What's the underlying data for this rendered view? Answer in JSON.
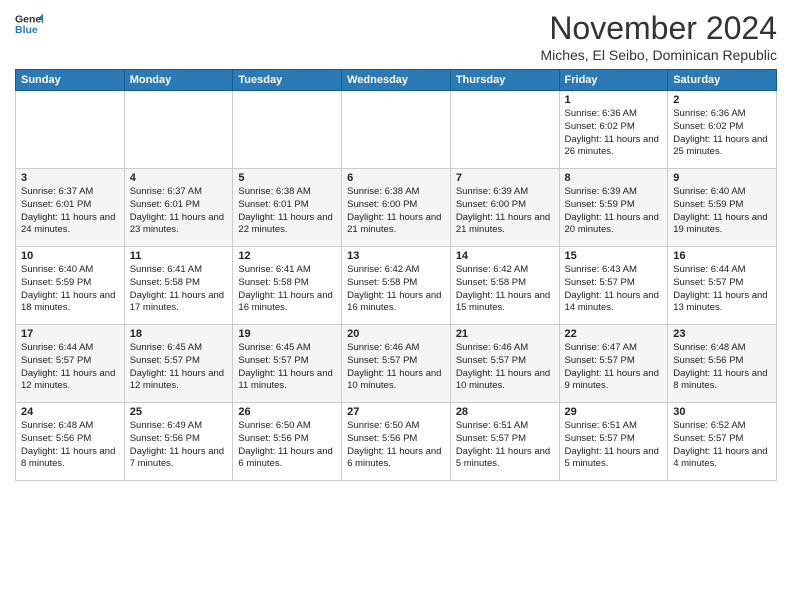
{
  "logo": {
    "line1": "General",
    "line2": "Blue"
  },
  "title": "November 2024",
  "location": "Miches, El Seibo, Dominican Republic",
  "weekdays": [
    "Sunday",
    "Monday",
    "Tuesday",
    "Wednesday",
    "Thursday",
    "Friday",
    "Saturday"
  ],
  "weeks": [
    [
      {
        "day": "",
        "info": ""
      },
      {
        "day": "",
        "info": ""
      },
      {
        "day": "",
        "info": ""
      },
      {
        "day": "",
        "info": ""
      },
      {
        "day": "",
        "info": ""
      },
      {
        "day": "1",
        "info": "Sunrise: 6:36 AM\nSunset: 6:02 PM\nDaylight: 11 hours and 26 minutes."
      },
      {
        "day": "2",
        "info": "Sunrise: 6:36 AM\nSunset: 6:02 PM\nDaylight: 11 hours and 25 minutes."
      }
    ],
    [
      {
        "day": "3",
        "info": "Sunrise: 6:37 AM\nSunset: 6:01 PM\nDaylight: 11 hours and 24 minutes."
      },
      {
        "day": "4",
        "info": "Sunrise: 6:37 AM\nSunset: 6:01 PM\nDaylight: 11 hours and 23 minutes."
      },
      {
        "day": "5",
        "info": "Sunrise: 6:38 AM\nSunset: 6:01 PM\nDaylight: 11 hours and 22 minutes."
      },
      {
        "day": "6",
        "info": "Sunrise: 6:38 AM\nSunset: 6:00 PM\nDaylight: 11 hours and 21 minutes."
      },
      {
        "day": "7",
        "info": "Sunrise: 6:39 AM\nSunset: 6:00 PM\nDaylight: 11 hours and 21 minutes."
      },
      {
        "day": "8",
        "info": "Sunrise: 6:39 AM\nSunset: 5:59 PM\nDaylight: 11 hours and 20 minutes."
      },
      {
        "day": "9",
        "info": "Sunrise: 6:40 AM\nSunset: 5:59 PM\nDaylight: 11 hours and 19 minutes."
      }
    ],
    [
      {
        "day": "10",
        "info": "Sunrise: 6:40 AM\nSunset: 5:59 PM\nDaylight: 11 hours and 18 minutes."
      },
      {
        "day": "11",
        "info": "Sunrise: 6:41 AM\nSunset: 5:58 PM\nDaylight: 11 hours and 17 minutes."
      },
      {
        "day": "12",
        "info": "Sunrise: 6:41 AM\nSunset: 5:58 PM\nDaylight: 11 hours and 16 minutes."
      },
      {
        "day": "13",
        "info": "Sunrise: 6:42 AM\nSunset: 5:58 PM\nDaylight: 11 hours and 16 minutes."
      },
      {
        "day": "14",
        "info": "Sunrise: 6:42 AM\nSunset: 5:58 PM\nDaylight: 11 hours and 15 minutes."
      },
      {
        "day": "15",
        "info": "Sunrise: 6:43 AM\nSunset: 5:57 PM\nDaylight: 11 hours and 14 minutes."
      },
      {
        "day": "16",
        "info": "Sunrise: 6:44 AM\nSunset: 5:57 PM\nDaylight: 11 hours and 13 minutes."
      }
    ],
    [
      {
        "day": "17",
        "info": "Sunrise: 6:44 AM\nSunset: 5:57 PM\nDaylight: 11 hours and 12 minutes."
      },
      {
        "day": "18",
        "info": "Sunrise: 6:45 AM\nSunset: 5:57 PM\nDaylight: 11 hours and 12 minutes."
      },
      {
        "day": "19",
        "info": "Sunrise: 6:45 AM\nSunset: 5:57 PM\nDaylight: 11 hours and 11 minutes."
      },
      {
        "day": "20",
        "info": "Sunrise: 6:46 AM\nSunset: 5:57 PM\nDaylight: 11 hours and 10 minutes."
      },
      {
        "day": "21",
        "info": "Sunrise: 6:46 AM\nSunset: 5:57 PM\nDaylight: 11 hours and 10 minutes."
      },
      {
        "day": "22",
        "info": "Sunrise: 6:47 AM\nSunset: 5:57 PM\nDaylight: 11 hours and 9 minutes."
      },
      {
        "day": "23",
        "info": "Sunrise: 6:48 AM\nSunset: 5:56 PM\nDaylight: 11 hours and 8 minutes."
      }
    ],
    [
      {
        "day": "24",
        "info": "Sunrise: 6:48 AM\nSunset: 5:56 PM\nDaylight: 11 hours and 8 minutes."
      },
      {
        "day": "25",
        "info": "Sunrise: 6:49 AM\nSunset: 5:56 PM\nDaylight: 11 hours and 7 minutes."
      },
      {
        "day": "26",
        "info": "Sunrise: 6:50 AM\nSunset: 5:56 PM\nDaylight: 11 hours and 6 minutes."
      },
      {
        "day": "27",
        "info": "Sunrise: 6:50 AM\nSunset: 5:56 PM\nDaylight: 11 hours and 6 minutes."
      },
      {
        "day": "28",
        "info": "Sunrise: 6:51 AM\nSunset: 5:57 PM\nDaylight: 11 hours and 5 minutes."
      },
      {
        "day": "29",
        "info": "Sunrise: 6:51 AM\nSunset: 5:57 PM\nDaylight: 11 hours and 5 minutes."
      },
      {
        "day": "30",
        "info": "Sunrise: 6:52 AM\nSunset: 5:57 PM\nDaylight: 11 hours and 4 minutes."
      }
    ]
  ]
}
